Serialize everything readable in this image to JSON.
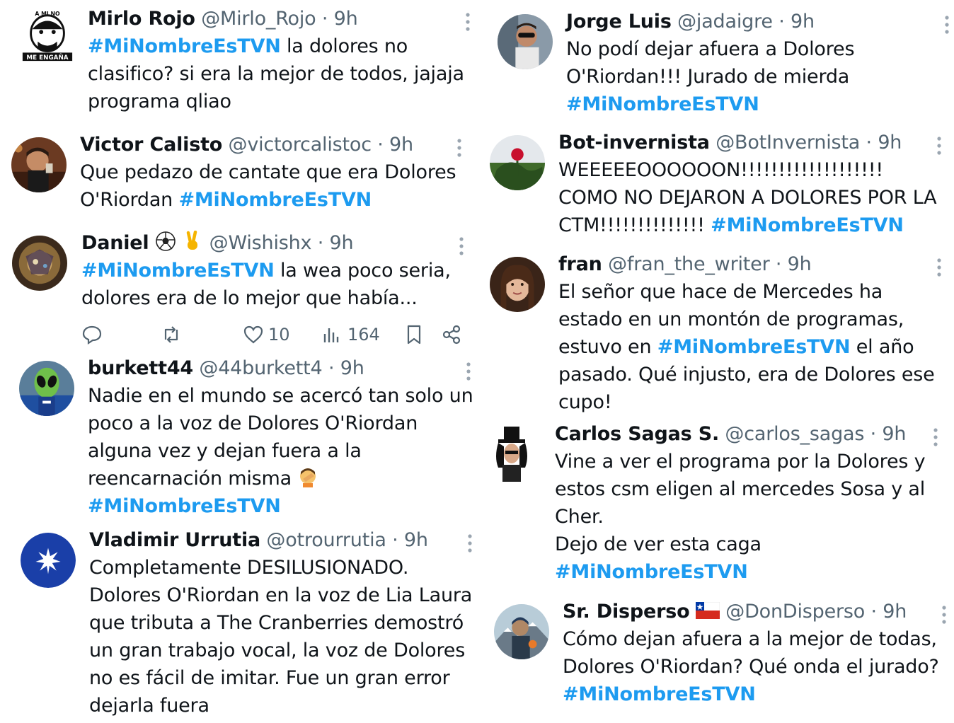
{
  "colors": {
    "hashtag": "#1d9bf0",
    "secondary_text": "#536471",
    "primary_text": "#0f1419"
  },
  "left_column": [
    {
      "name": "Mirlo Rojo",
      "handle": "@Mirlo_Rojo",
      "dot": "·",
      "time": "9h",
      "lines": [
        {
          "hashtag": "#MiNombreEsTVN",
          "text": " la dolores no"
        },
        {
          "text": "clasifico? si era la mejor de todos, jajaja"
        },
        {
          "text": "programa qliao"
        }
      ],
      "avatar": "meme-face-avatar"
    },
    {
      "name": "Victor Calisto",
      "handle": "@victorcalistoc",
      "dot": "·",
      "time": "9h",
      "lines": [
        {
          "text": "Que pedazo de cantate que era Dolores"
        },
        {
          "text": "O'Riordan ",
          "hashtag": "#MiNombreEsTVN"
        }
      ],
      "avatar": "man-photo-avatar"
    },
    {
      "name": "Daniel",
      "name_emojis": [
        "soccer-ball-icon",
        "victory-hand-icon"
      ],
      "handle": "@Wishishx",
      "dot": "·",
      "time": "9h",
      "lines": [
        {
          "hashtag": "#MiNombreEsTVN",
          "text": " la wea poco seria,"
        },
        {
          "text": "dolores era de lo mejor que había..."
        }
      ],
      "avatar": "fantasy-art-avatar",
      "actions": {
        "reply": "",
        "retweet": "",
        "likes": "10",
        "views": "164",
        "bookmark": "",
        "share": ""
      }
    },
    {
      "name": "burkett44",
      "handle": "@44burkett4",
      "dot": "·",
      "time": "9h",
      "lines": [
        {
          "text": "Nadie en el mundo se acercó tan solo un"
        },
        {
          "text": "poco a la  voz de Dolores O'Riordan"
        },
        {
          "text": "alguna vez y dejan fuera a la"
        },
        {
          "text": "reencarnación misma",
          "emoji": "facepalm-icon"
        },
        {
          "hashtag": "#MiNombreEsTVN"
        }
      ],
      "avatar": "alien-avatar"
    },
    {
      "name": "Vladimir Urrutia",
      "handle": "@otrourrutia",
      "dot": "·",
      "time": "9h",
      "lines": [
        {
          "text": "Completamente DESILUSIONADO."
        },
        {
          "text": "Dolores O'Riordan en la voz de Lia Laura"
        },
        {
          "text": "que tributa a The Cranberries demostró"
        },
        {
          "text": "un gran trabajo vocal, la voz de Dolores"
        },
        {
          "text": "no es fácil de imitar. Fue un gran error"
        },
        {
          "text": "dejarla fuera"
        }
      ],
      "avatar": "star-avatar"
    }
  ],
  "right_column": [
    {
      "name": "Jorge Luis",
      "handle": "@jadaigre",
      "dot": "·",
      "time": "9h",
      "lines": [
        {
          "text": "No podí dejar afuera a Dolores"
        },
        {
          "text": "O'Riordan!!! Jurado de mierda"
        },
        {
          "hashtag": "#MiNombreEsTVN"
        }
      ],
      "avatar": "driver-avatar"
    },
    {
      "name": "Bot-invernista",
      "handle": "@BotInvernista",
      "dot": "·",
      "time": "9h",
      "lines": [
        {
          "text": "WEEEEEOOOOOON!!!!!!!!!!!!!!!!!!!"
        },
        {
          "text": "COMO NO DEJARON A DOLORES POR LA"
        },
        {
          "text": "CTM!!!!!!!!!!!!!! ",
          "hashtag": "#MiNombreEsTVN"
        }
      ],
      "avatar": "rose-avatar"
    },
    {
      "name": "fran",
      "handle": "@fran_the_writer",
      "dot": "·",
      "time": "9h",
      "lines": [
        {
          "text": "El señor que hace de Mercedes ha"
        },
        {
          "text": "estado en un montón de programas,"
        },
        {
          "text": "estuvo en ",
          "hashtag": "#MiNombreEsTVN",
          "after": " el año"
        },
        {
          "text": "pasado. Qué injusto, era de Dolores ese"
        },
        {
          "text": "cupo!"
        }
      ],
      "avatar": "woman-avatar"
    },
    {
      "name": "Carlos Sagas S.",
      "handle": "@carlos_sagas",
      "dot": "·",
      "time": "9h",
      "lines": [
        {
          "text": "Vine a ver el programa por la Dolores y"
        },
        {
          "text": "estos csm eligen al mercedes Sosa y al"
        },
        {
          "text": "Cher."
        },
        {
          "text": "Dejo de ver esta caga"
        },
        {
          "hashtag": "#MiNombreEsTVN"
        }
      ],
      "avatar": "top-hat-avatar"
    },
    {
      "name": "Sr. Disperso",
      "name_emojis": [
        "chile-flag-icon"
      ],
      "handle": "@DonDisperso",
      "dot": "·",
      "time": "9h",
      "lines": [
        {
          "text": "Cómo dejan afuera a la mejor de todas,"
        },
        {
          "text": "Dolores O'Riordan? Qué onda el jurado?"
        },
        {
          "hashtag": "#MiNombreEsTVN"
        }
      ],
      "avatar": "hiker-avatar"
    }
  ]
}
